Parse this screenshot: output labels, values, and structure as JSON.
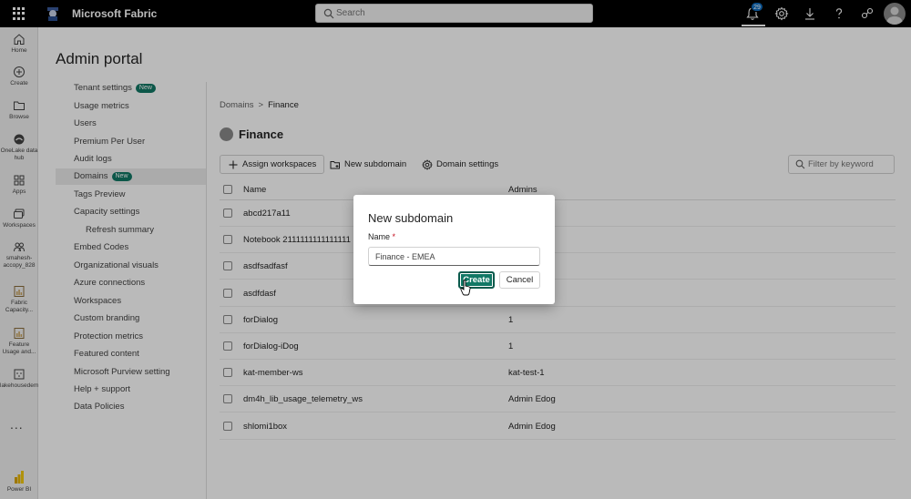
{
  "app": {
    "brand": "Microsoft Fabric",
    "search_placeholder": "Search",
    "notification_count": "29"
  },
  "rail": {
    "items": [
      {
        "label": "Home",
        "icon": "home-icon"
      },
      {
        "label": "Create",
        "icon": "plus-circle-icon"
      },
      {
        "label": "Browse",
        "icon": "folder-icon"
      },
      {
        "label": "OneLake data hub",
        "icon": "onelake-icon"
      },
      {
        "label": "Apps",
        "icon": "apps-icon"
      },
      {
        "label": "Workspaces",
        "icon": "workspaces-icon"
      },
      {
        "label": "smahesh-accopy_828",
        "icon": "workspace-people-icon"
      },
      {
        "label": "Fabric Capacity...",
        "icon": "report-icon"
      },
      {
        "label": "Feature Usage and...",
        "icon": "report-icon"
      },
      {
        "label": "lakehousedemo",
        "icon": "lakehouse-icon"
      }
    ],
    "more": "...",
    "powerbi_label": "Power BI"
  },
  "page": {
    "title": "Admin portal"
  },
  "admin_nav": [
    {
      "label": "Tenant settings",
      "badge": "New"
    },
    {
      "label": "Usage metrics"
    },
    {
      "label": "Users"
    },
    {
      "label": "Premium Per User"
    },
    {
      "label": "Audit logs"
    },
    {
      "label": "Domains",
      "badge": "New",
      "active": true
    },
    {
      "label": "Tags Preview"
    },
    {
      "label": "Capacity settings"
    },
    {
      "label": "Refresh summary",
      "sub": true
    },
    {
      "label": "Embed Codes"
    },
    {
      "label": "Organizational visuals"
    },
    {
      "label": "Azure connections"
    },
    {
      "label": "Workspaces"
    },
    {
      "label": "Custom branding"
    },
    {
      "label": "Protection metrics"
    },
    {
      "label": "Featured content"
    },
    {
      "label": "Microsoft Purview setting"
    },
    {
      "label": "Help + support"
    },
    {
      "label": "Data Policies"
    }
  ],
  "breadcrumb": {
    "parent": "Domains",
    "separator": ">",
    "current": "Finance"
  },
  "domain": {
    "name": "Finance"
  },
  "toolbar": {
    "assign": "Assign workspaces",
    "new_subdomain": "New subdomain",
    "settings": "Domain settings",
    "filter_placeholder": "Filter by keyword"
  },
  "table": {
    "columns": {
      "name": "Name",
      "admins": "Admins"
    },
    "rows": [
      {
        "name": "abcd217a11",
        "admins": ""
      },
      {
        "name": "Notebook 2111111111111111",
        "admins": ""
      },
      {
        "name": "asdfsadfasf",
        "admins": ""
      },
      {
        "name": "asdfdasf",
        "admins": ""
      },
      {
        "name": "forDialog",
        "admins": "1"
      },
      {
        "name": "forDialog-iDog",
        "admins": "1"
      },
      {
        "name": "kat-member-ws",
        "admins": "kat-test-1"
      },
      {
        "name": "dm4h_lib_usage_telemetry_ws",
        "admins": "Admin Edog"
      },
      {
        "name": "shlomi1box",
        "admins": "Admin Edog"
      }
    ]
  },
  "dialog": {
    "title": "New subdomain",
    "name_label": "Name",
    "required_mark": "*",
    "name_value": "Finance - EMEA",
    "create": "Create",
    "cancel": "Cancel"
  },
  "colors": {
    "accent": "#117865",
    "topbar": "#000000",
    "badge_blue": "#0f6cbd"
  }
}
